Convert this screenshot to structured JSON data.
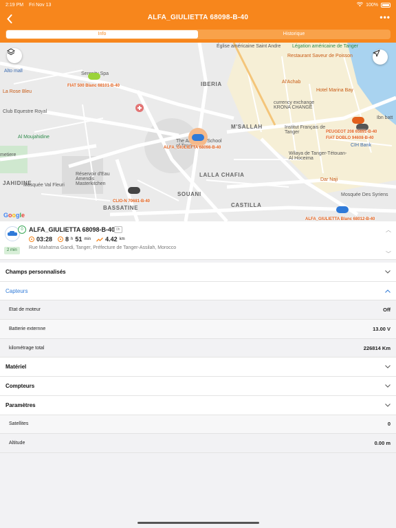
{
  "status": {
    "time": "2:19 PM",
    "date": "Fri Nov 13",
    "battery": "100%"
  },
  "header": {
    "title": "ALFA_GIULIETTA 68098-B-40"
  },
  "tabs": [
    {
      "label": "Info",
      "active": true
    },
    {
      "label": "Historique",
      "active": false
    }
  ],
  "map": {
    "places": {
      "eglise": "Église américaine Saint Andre",
      "legation": "Légation américaine de Tanger",
      "restaurant": "Restaurant Saveur de Poisson",
      "alto": "Alto mall",
      "serenity": "Serenity Spa",
      "achab": "Al'Achab",
      "marina": "Hotel Marina Bay",
      "rose": "La Rose Bleu",
      "equestre": "Club Equestre Royal",
      "currency": "currency exchange KRONA CHANGE",
      "moujahidine": "Al Moujahidine",
      "msallah": "M'SALLAH",
      "institut": "Institut Français de Tanger",
      "iberia": "IBERIA",
      "american_school": "The American School of Tangier",
      "cihbank": "CIH Bank",
      "wilaya": "Wilaya de Tanger-Tétouan-Al Hoceima",
      "dar_naji": "Dar Naji",
      "lalla_chafia": "LALLA CHAFIA",
      "cimetiere": "metiere",
      "djahidine": "JAHIDINE",
      "mosquee_vf": "Mosquée Val Fleuri",
      "reservoir": "Réservoir d'Eau Amendis Masterkitchen",
      "souani": "SOUANI",
      "bassatine": "BASSATINE",
      "castilla": "CASTILLA",
      "mosquee_syriens": "Mosquée Des Syriens",
      "ibn_batt": "Ibn batt",
      "google": "Google"
    },
    "cars": {
      "fiat": "FIAT 500 Blanc 68101-B-40",
      "alfa": "ALFA_GIULIETTA 68098-B-40",
      "clio": "CLIO-N 70681-B-40",
      "peugeot": "PEUGEOT 208 65891-B-40",
      "fiat2": "FIAT DOBLO 94608-B-40",
      "bottom_right": "ALFA_GIULIETTA Blanc 68012-B-40"
    }
  },
  "vehicle": {
    "name": "ALFA_GIULIETTA 68098-B-40",
    "tag": "0h",
    "badge": "0",
    "since": "2 min",
    "idle_time": "03:28",
    "drive_hours": "8",
    "drive_h_unit": "h",
    "drive_minutes": "51",
    "drive_min_unit": "min",
    "distance": "4.42",
    "distance_unit": "km",
    "address": "Rue Mahatma Gandi, Tanger, Préfecture de Tanger-Assilah, Morocco"
  },
  "sections": {
    "champs": "Champs personnalisés",
    "capteurs": "Capteurs",
    "materiel": "Matériel",
    "compteurs": "Compteurs",
    "parametres": "Paramètres"
  },
  "capteurs": [
    {
      "label": "Etat de moteur",
      "value": "Off"
    },
    {
      "label": "Batterie externne",
      "value": "13.00 V"
    },
    {
      "label": "kilométrage total",
      "value": "226814 Km"
    }
  ],
  "parametres": [
    {
      "label": "Satellites",
      "value": "0"
    },
    {
      "label": "Altitude",
      "value": "0.00 m"
    }
  ],
  "colors": {
    "accent": "#f7861c",
    "link": "#2f7ad8"
  }
}
